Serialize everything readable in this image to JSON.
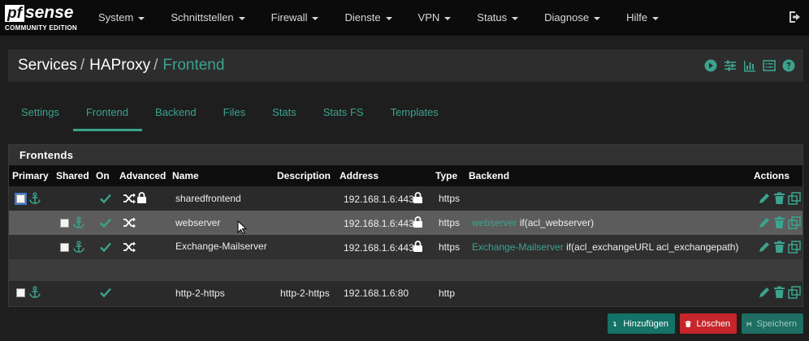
{
  "navbar": {
    "brand_pf": "pf",
    "brand_sense": "sense",
    "brand_edition": "COMMUNITY EDITION",
    "menu": [
      {
        "label": "System"
      },
      {
        "label": "Schnittstellen"
      },
      {
        "label": "Firewall"
      },
      {
        "label": "Dienste"
      },
      {
        "label": "VPN"
      },
      {
        "label": "Status"
      },
      {
        "label": "Diagnose"
      },
      {
        "label": "Hilfe"
      }
    ],
    "logout_icon": "sign-out-icon"
  },
  "header": {
    "crumb1": "Services",
    "crumb2": "HAProxy",
    "crumb3": "Frontend",
    "sep": "/",
    "icons": [
      "play-icon",
      "sliders-icon",
      "bar-chart-icon",
      "list-icon",
      "question-icon"
    ]
  },
  "tabs": [
    {
      "label": "Settings"
    },
    {
      "label": "Frontend"
    },
    {
      "label": "Backend"
    },
    {
      "label": "Files"
    },
    {
      "label": "Stats"
    },
    {
      "label": "Stats FS"
    },
    {
      "label": "Templates"
    }
  ],
  "active_tab": "Frontend",
  "panel": {
    "title": "Frontends",
    "columns": {
      "primary": "Primary",
      "shared": "Shared",
      "on": "On",
      "advanced": "Advanced",
      "name": "Name",
      "description": "Description",
      "address": "Address",
      "type": "Type",
      "backend": "Backend",
      "actions": "Actions"
    },
    "rows": [
      {
        "name": "sharedfrontend",
        "description": "",
        "address": "192.168.1.6:443",
        "type": "https",
        "backend_link": "",
        "backend_cond": ""
      },
      {
        "name": "webserver",
        "description": "",
        "address": "192.168.1.6:443",
        "type": "https",
        "backend_link": "webserver",
        "backend_cond": "if(acl_webserver)"
      },
      {
        "name": "Exchange-Mailserver",
        "description": "",
        "address": "192.168.1.6:443",
        "type": "https",
        "backend_link": "Exchange-Mailserver",
        "backend_cond": "if(acl_exchangeURL acl_exchangepath)"
      },
      {
        "name": "http-2-https",
        "description": "http-2-https",
        "address": "192.168.1.6:80",
        "type": "http",
        "backend_link": "",
        "backend_cond": ""
      }
    ]
  },
  "buttons": {
    "add": "Hinzufügen",
    "delete": "Löschen",
    "save": "Speichern"
  },
  "colors": {
    "accent": "#3ba38e",
    "navbar": "#0b0b0b",
    "danger": "#c6262b",
    "add": "#147266"
  }
}
